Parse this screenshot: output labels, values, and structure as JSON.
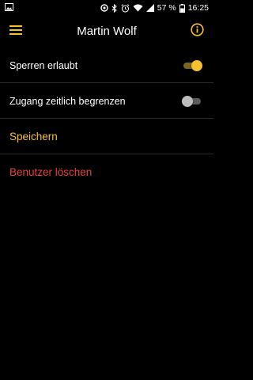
{
  "status_bar": {
    "battery_percent": "57 %",
    "time": "16:25",
    "icons": [
      "image-icon",
      "sync-icon",
      "bluetooth-icon",
      "alarm-icon",
      "wifi-icon",
      "signal-icon",
      "battery-icon"
    ]
  },
  "app_bar": {
    "title": "Martin Wolf",
    "menu_icon": "hamburger-menu-icon",
    "info_icon": "info-icon"
  },
  "settings": [
    {
      "label": "Sperren erlaubt",
      "toggle_on": true
    },
    {
      "label": "Zugang zeitlich begrenzen",
      "toggle_on": false
    }
  ],
  "actions": {
    "save_label": "Speichern",
    "delete_label": "Benutzer löschen"
  },
  "colors": {
    "background": "#000000",
    "accent": "#f5c12e",
    "danger": "#e8413a",
    "divider": "#2a2a2a"
  }
}
